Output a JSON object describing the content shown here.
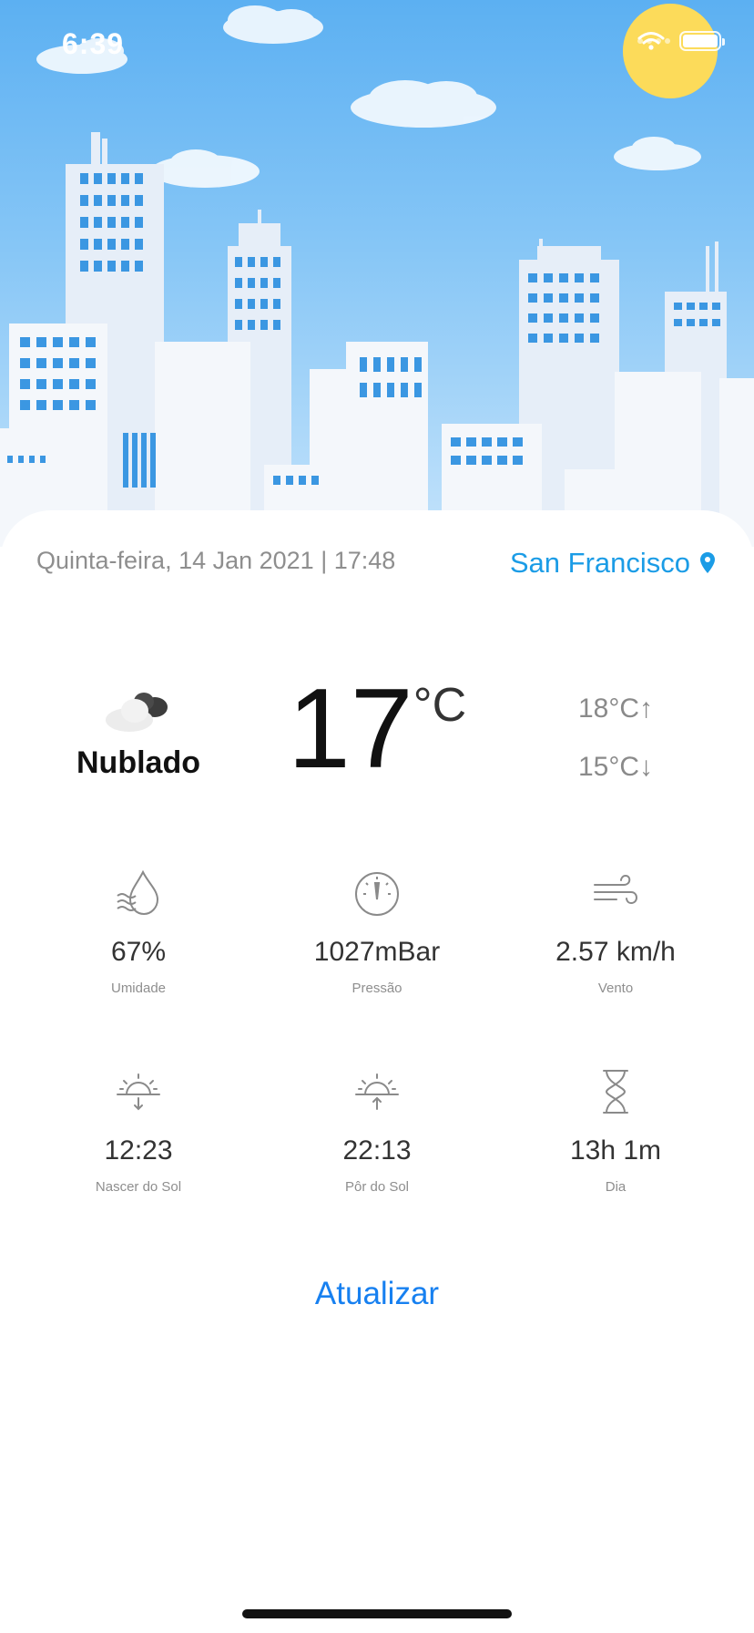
{
  "status_bar": {
    "time": "6:39"
  },
  "location": {
    "date_text": "Quinta-feira, 14 Jan 2021 | 17:48",
    "city": "San Francisco"
  },
  "current": {
    "condition": "Nublado",
    "temperature": "17",
    "unit": "°C",
    "max": "18°C↑",
    "min": "15°C↓"
  },
  "stats": [
    {
      "value": "67%",
      "label": "Umidade",
      "icon": "humidity-icon"
    },
    {
      "value": "1027mBar",
      "label": "Pressão",
      "icon": "pressure-gauge-icon"
    },
    {
      "value": "2.57 km/h",
      "label": "Vento",
      "icon": "wind-icon"
    },
    {
      "value": "12:23",
      "label": "Nascer do Sol",
      "icon": "sunrise-icon"
    },
    {
      "value": "22:13",
      "label": "Pôr do Sol",
      "icon": "sunset-icon"
    },
    {
      "value": "13h 1m",
      "label": "Dia",
      "icon": "hourglass-icon"
    }
  ],
  "actions": {
    "refresh_label": "Atualizar"
  },
  "colors": {
    "accent": "#1b9ce6",
    "button": "#1780f0",
    "sky": "#5cb0f2",
    "sun": "#fbd33a"
  }
}
